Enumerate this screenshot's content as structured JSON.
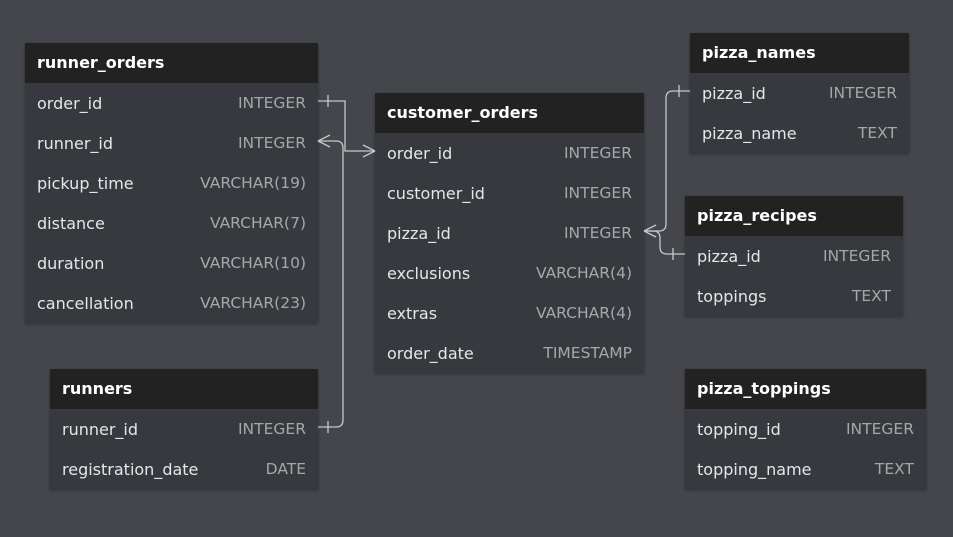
{
  "tables": {
    "runner_orders": {
      "name": "runner_orders",
      "fields": [
        {
          "name": "order_id",
          "type": "INTEGER"
        },
        {
          "name": "runner_id",
          "type": "INTEGER"
        },
        {
          "name": "pickup_time",
          "type": "VARCHAR(19)"
        },
        {
          "name": "distance",
          "type": "VARCHAR(7)"
        },
        {
          "name": "duration",
          "type": "VARCHAR(10)"
        },
        {
          "name": "cancellation",
          "type": "VARCHAR(23)"
        }
      ]
    },
    "runners": {
      "name": "runners",
      "fields": [
        {
          "name": "runner_id",
          "type": "INTEGER"
        },
        {
          "name": "registration_date",
          "type": "DATE"
        }
      ]
    },
    "customer_orders": {
      "name": "customer_orders",
      "fields": [
        {
          "name": "order_id",
          "type": "INTEGER"
        },
        {
          "name": "customer_id",
          "type": "INTEGER"
        },
        {
          "name": "pizza_id",
          "type": "INTEGER"
        },
        {
          "name": "exclusions",
          "type": "VARCHAR(4)"
        },
        {
          "name": "extras",
          "type": "VARCHAR(4)"
        },
        {
          "name": "order_date",
          "type": "TIMESTAMP"
        }
      ]
    },
    "pizza_names": {
      "name": "pizza_names",
      "fields": [
        {
          "name": "pizza_id",
          "type": "INTEGER"
        },
        {
          "name": "pizza_name",
          "type": "TEXT"
        }
      ]
    },
    "pizza_recipes": {
      "name": "pizza_recipes",
      "fields": [
        {
          "name": "pizza_id",
          "type": "INTEGER"
        },
        {
          "name": "toppings",
          "type": "TEXT"
        }
      ]
    },
    "pizza_toppings": {
      "name": "pizza_toppings",
      "fields": [
        {
          "name": "topping_id",
          "type": "INTEGER"
        },
        {
          "name": "topping_name",
          "type": "TEXT"
        }
      ]
    }
  },
  "colors": {
    "canvas": "#45464c",
    "header": "#222222",
    "body": "#38393e",
    "connector": "#c8c8c8"
  }
}
